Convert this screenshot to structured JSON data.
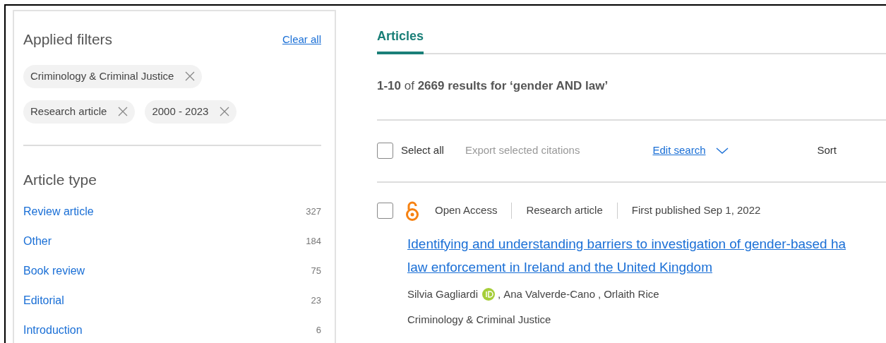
{
  "sidebar": {
    "title": "Applied filters",
    "clear_all": "Clear all",
    "chips": [
      {
        "label": "Criminology & Criminal Justice"
      },
      {
        "label": "Research article"
      },
      {
        "label": "2000 - 2023"
      }
    ],
    "facet": {
      "title": "Article type",
      "items": [
        {
          "label": "Review article",
          "count": "327"
        },
        {
          "label": "Other",
          "count": "184"
        },
        {
          "label": "Book review",
          "count": "75"
        },
        {
          "label": "Editorial",
          "count": "23"
        },
        {
          "label": "Introduction",
          "count": "6"
        }
      ]
    }
  },
  "tabs": [
    {
      "label": "Articles",
      "selected": true
    }
  ],
  "results_summary": "**1-10** of **2669 results for ‘gender AND law’**",
  "toolbar": {
    "select_all": {
      "label": "Select all",
      "checked": false
    },
    "export": "Export selected citations",
    "edit_search": "Edit search",
    "sort": "Sort"
  },
  "articles": [
    {
      "checked": false,
      "open_access": true,
      "meta": [
        "Open Access",
        "Research article",
        "First published Sep 1, 2022"
      ],
      "title_lines": [
        "Identifying and understanding barriers to investigation of gender-based ha",
        "law enforcement in Ireland and the United Kingdom"
      ],
      "author_separator": ",",
      "authors": [
        {
          "name": "Silvia Gagliardi",
          "orcid": true
        },
        {
          "name": "Ana Valverde-Cano",
          "orcid": false
        },
        {
          "name": "Orlaith Rice",
          "orcid": false
        }
      ],
      "journal": "Criminology & Criminal Justice"
    }
  ]
}
